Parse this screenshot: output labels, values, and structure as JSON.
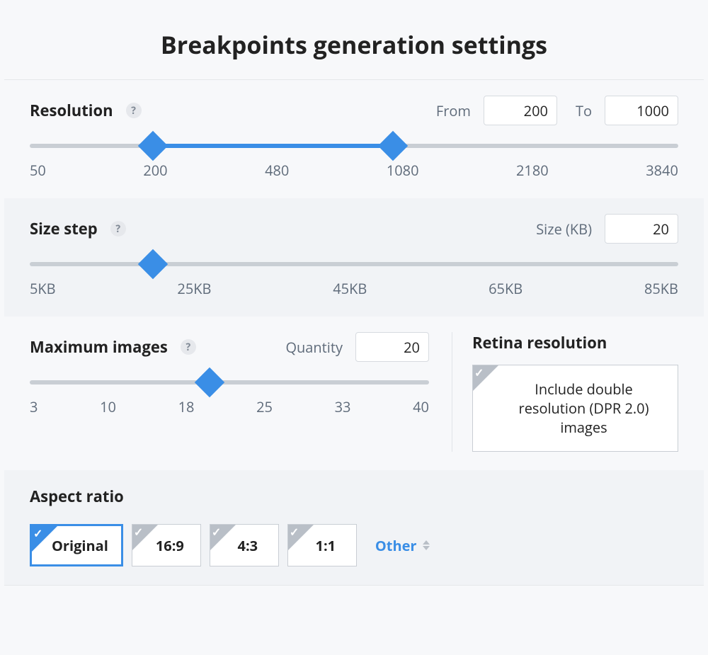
{
  "title": "Breakpoints generation settings",
  "resolution": {
    "label": "Resolution",
    "from_label": "From",
    "to_label": "To",
    "from_value": "200",
    "to_value": "1000",
    "ticks": [
      "50",
      "200",
      "480",
      "1080",
      "2180",
      "3840"
    ],
    "slider": {
      "from_pct": 19,
      "to_pct": 56
    }
  },
  "size_step": {
    "label": "Size step",
    "size_label": "Size (KB)",
    "size_value": "20",
    "ticks": [
      "5KB",
      "25KB",
      "45KB",
      "65KB",
      "85KB"
    ],
    "slider": {
      "pos_pct": 19
    }
  },
  "max_images": {
    "label": "Maximum images",
    "qty_label": "Quantity",
    "qty_value": "20",
    "ticks": [
      "3",
      "10",
      "18",
      "25",
      "33",
      "40"
    ],
    "slider": {
      "pos_pct": 45
    }
  },
  "retina": {
    "label": "Retina resolution",
    "option": "Include double resolution (DPR 2.0) images",
    "checked": false
  },
  "aspect": {
    "label": "Aspect ratio",
    "options": [
      "Original",
      "16:9",
      "4:3",
      "1:1"
    ],
    "selected_index": 0,
    "other_label": "Other"
  }
}
